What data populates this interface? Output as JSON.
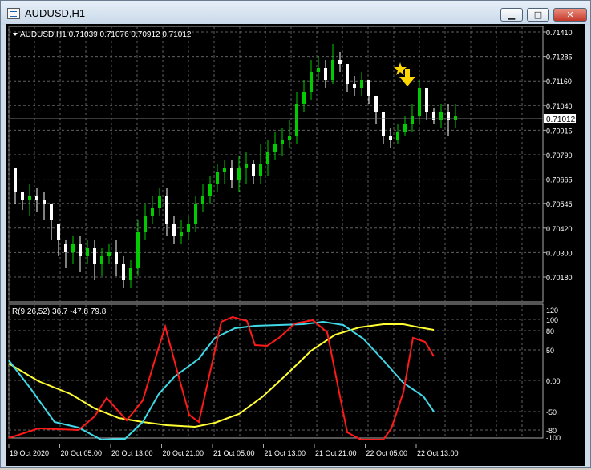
{
  "window": {
    "title": "AUDUSD,H1",
    "buttons": {
      "minimize": "▁",
      "maximize": "□",
      "close": "✕"
    }
  },
  "main_panel": {
    "info_label": "AUDUSD,H1  0.71039 0.71076 0.70912 0.71012",
    "current_price_label": "0.71012",
    "price_ticks": [
      "0.71410",
      "0.71285",
      "0.71160",
      "0.71040",
      "0.70915",
      "0.70790",
      "0.70665",
      "0.70545",
      "0.70420",
      "0.70300",
      "0.70180"
    ]
  },
  "indicator_panel": {
    "label": "R(9,26,52) 36.7 -47.8 79.8",
    "ticks": [
      "120",
      "100",
      "80",
      "50",
      "0.00",
      "-50",
      "-80",
      "-100"
    ]
  },
  "time_axis": {
    "labels": [
      "19 Oct 2020",
      "20 Oct 05:00",
      "20 Oct 13:00",
      "20 Oct 21:00",
      "21 Oct 05:00",
      "21 Oct 13:00",
      "21 Oct 21:00",
      "22 Oct 05:00",
      "22 Oct 13:00"
    ]
  },
  "colors": {
    "background": "#000000",
    "bull_candle": "#00cc00",
    "bear_candle": "#ffffff",
    "grid": "#606060",
    "series_red": "#ff1a1a",
    "series_cyan": "#3fd9e8",
    "series_yellow": "#ffff33",
    "signal_arrow": "#ffd700"
  },
  "icons": {
    "signal": "down-arrow-icon",
    "star": "star-icon"
  }
}
